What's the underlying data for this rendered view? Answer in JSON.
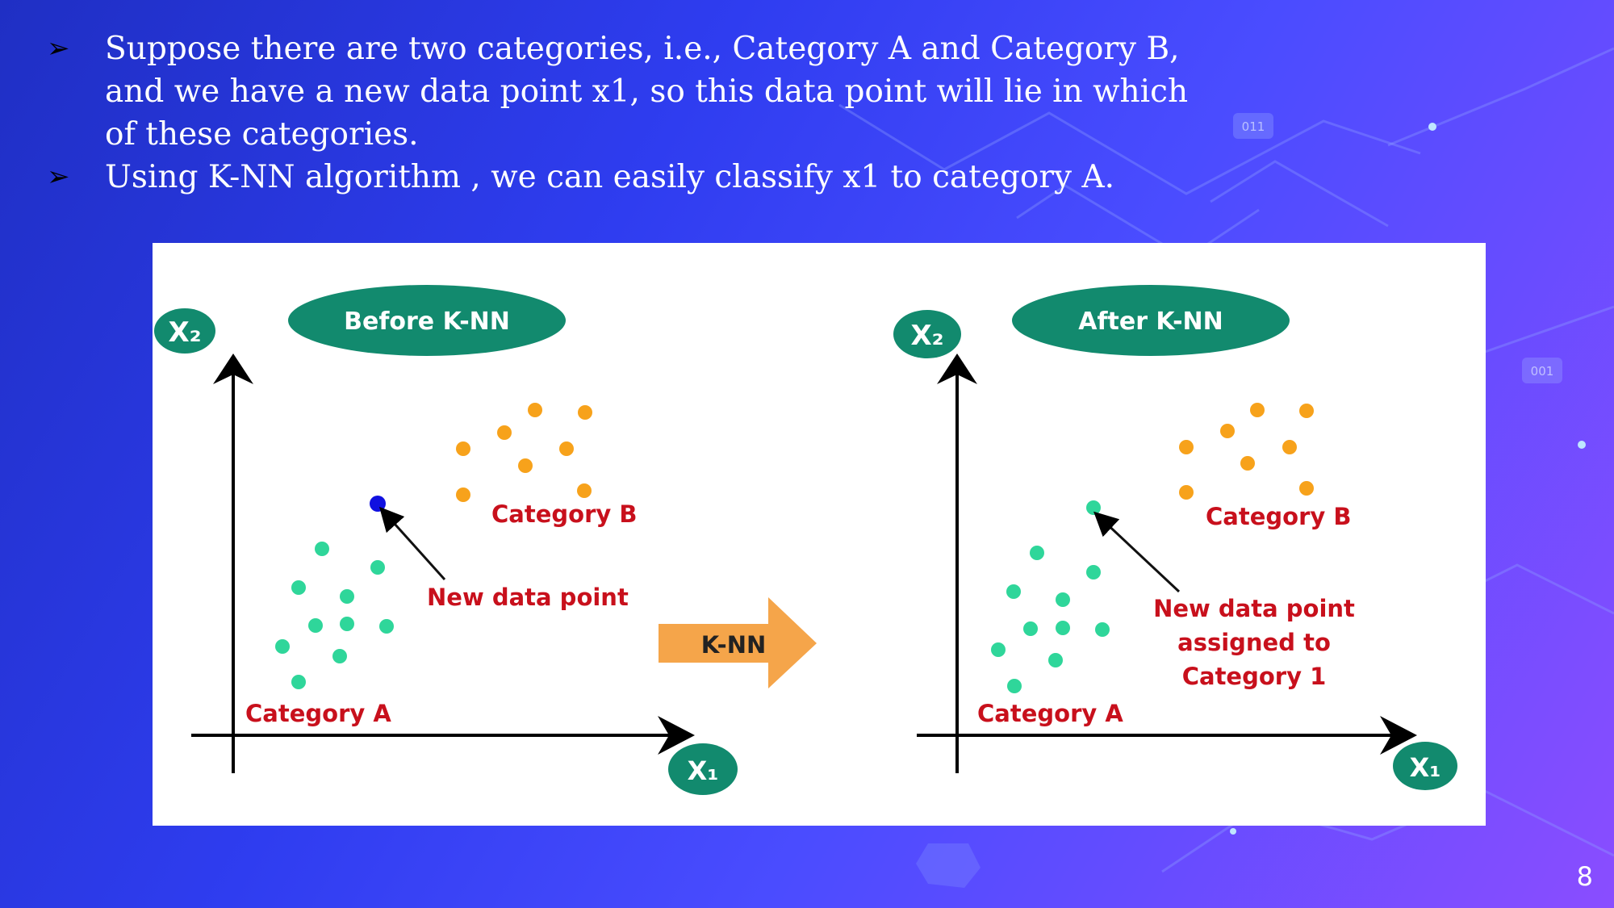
{
  "bullets": [
    {
      "icon": "arrowhead-bullet-icon",
      "text_lines": [
        "Suppose there are two categories, i.e., Category A and Category B,",
        "and we have a new data point x1, so this data point will lie in which",
        "of these categories."
      ]
    },
    {
      "icon": "arrowhead-bullet-icon",
      "text_lines": [
        "Using K-NN algorithm , we can easily classify x1 to category A."
      ]
    }
  ],
  "bg_badges": [
    "011",
    "001"
  ],
  "diagram": {
    "before": {
      "title": "Before K-NN",
      "y_axis_label": "X₂",
      "x_axis_label": "X₁",
      "category_a_label": "Category A",
      "category_b_label": "Category B",
      "new_point_label": "New data point"
    },
    "arrow_label": "K-NN",
    "after": {
      "title": "After K-NN",
      "y_axis_label": "X₂",
      "x_axis_label": "X₁",
      "category_a_label": "Category A",
      "category_b_label": "Category B",
      "new_point_label_lines": [
        "New data point",
        "assigned to",
        "Category 1"
      ]
    }
  },
  "colors": {
    "category_a": "#2fd69a",
    "category_b": "#f7a21b",
    "new_point": "#1010e0",
    "ellipse": "#128a6e",
    "label_red": "#c8101c",
    "arrow_orange": "#f5a54a"
  },
  "page_number": "8"
}
